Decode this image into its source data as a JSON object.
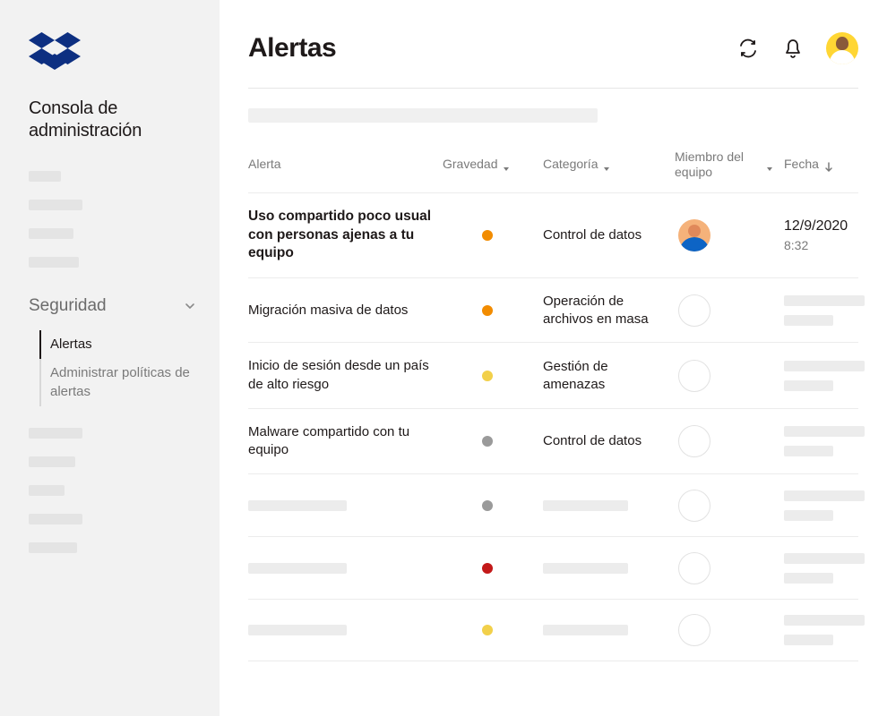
{
  "sidebar": {
    "console_title": "Consola de administración",
    "security": {
      "label": "Seguridad",
      "items": [
        {
          "label": "Alertas",
          "active": true
        },
        {
          "label": "Administrar políticas de alertas",
          "active": false
        }
      ]
    }
  },
  "header": {
    "title": "Alertas"
  },
  "columns": {
    "alert": "Alerta",
    "severity": "Gravedad",
    "category": "Categoría",
    "member": "Miembro del equipo",
    "date": "Fecha"
  },
  "severity_colors": {
    "orange": "#f28c00",
    "yellow": "#f2d04a",
    "gray": "#9a9a9a",
    "red": "#c31919"
  },
  "rows": [
    {
      "title": "Uso compartido poco usual con personas ajenas a tu equipo",
      "bold": true,
      "severity": "orange",
      "category": "Control de datos",
      "member": "avatar",
      "date": "12/9/2020",
      "time": "8:32"
    },
    {
      "title": "Migración masiva de datos",
      "bold": false,
      "severity": "orange",
      "category": "Operación de archivos en masa",
      "member": "empty",
      "date": "",
      "time": ""
    },
    {
      "title": "Inicio de sesión desde un país de alto riesgo",
      "bold": false,
      "severity": "yellow",
      "category": "Gestión de amenazas",
      "member": "empty",
      "date": "",
      "time": ""
    },
    {
      "title": "Malware compartido con tu equipo",
      "bold": false,
      "severity": "gray",
      "category": "Control de datos",
      "member": "empty",
      "date": "",
      "time": ""
    },
    {
      "title": "",
      "bold": false,
      "severity": "gray",
      "category": "",
      "member": "empty",
      "date": "",
      "time": ""
    },
    {
      "title": "",
      "bold": false,
      "severity": "red",
      "category": "",
      "member": "empty",
      "date": "",
      "time": ""
    },
    {
      "title": "",
      "bold": false,
      "severity": "yellow",
      "category": "",
      "member": "empty",
      "date": "",
      "time": ""
    }
  ]
}
